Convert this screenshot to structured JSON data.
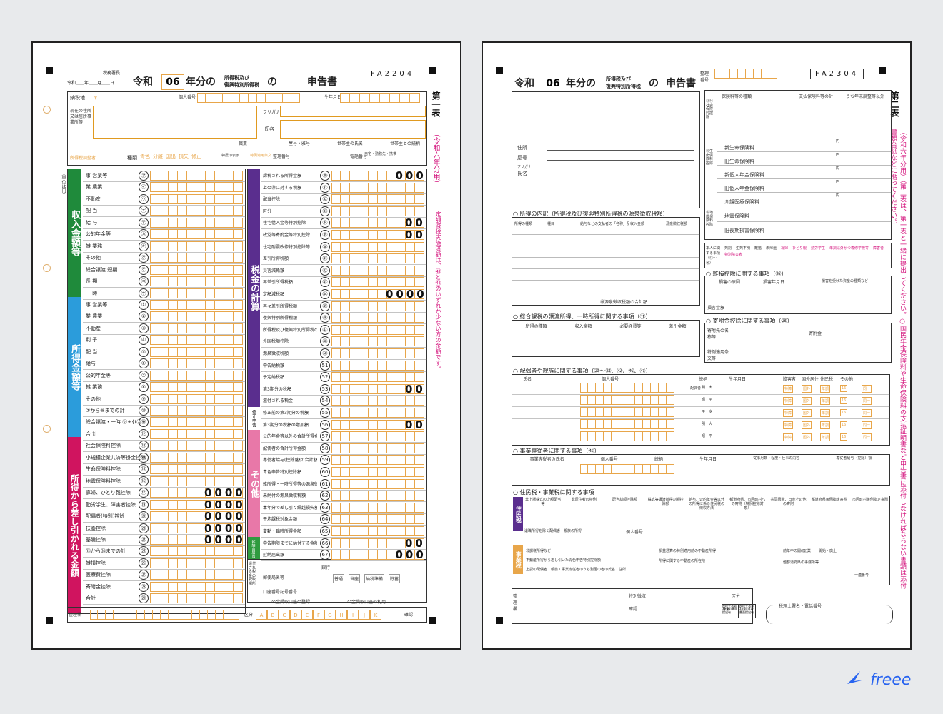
{
  "page1": {
    "header": {
      "tax_office": "税務署長",
      "date_label": "令和＿＿年＿＿月＿＿日",
      "era": "令和",
      "year": "06",
      "year_suffix": "年分の",
      "tax_name_top": "所得税及び",
      "tax_name_bottom": "復興特別所得税",
      "no": "の",
      "doc": "申告書",
      "code": "FA2204",
      "table_no": "第一表",
      "year_note": "（令和六年分用）",
      "pink_note": "定額減税実施済額は、㊸と㊹のいずれか少ない方の金額です。"
    },
    "address_block": {
      "nozeichi": "納税地",
      "postal": "〒",
      "kojin_bango": "個人番号",
      "seinengappi": "生年月日",
      "genzai_label": "現在の住所又は居所事業所等",
      "furigana": "フリガナ",
      "shimei": "氏名",
      "shokugyo": "職業",
      "yago": "屋号・雅号",
      "setainushi": "世帯主の氏名",
      "setainushi_zoku": "世帯主との続柄",
      "denwa": "電話番号",
      "jitaku": "自宅・勤務先・携帯",
      "shotoku_kubun": "所得税調整者",
      "shubetsu": "種類",
      "shubetsu_items": [
        "青色",
        "分離",
        "国出",
        "損失",
        "修正"
      ],
      "tokunou": "特農の表示",
      "tokurei": "特例適用条文",
      "seiri": "整理番号"
    },
    "income": {
      "band": "収入金額等",
      "unit": "（単位は円）",
      "rows": [
        {
          "label": "事 営業等",
          "no": "㋐"
        },
        {
          "label": "業 農業",
          "no": "㋑"
        },
        {
          "label": "不動産",
          "no": "㋒"
        },
        {
          "label": "配 当",
          "no": "㋓"
        },
        {
          "label": "給 与",
          "no": "㋔"
        },
        {
          "label": "公的年金等",
          "no": "㋕"
        },
        {
          "label": "雑 業務",
          "no": "㋖"
        },
        {
          "label": "その他",
          "no": "㋗"
        },
        {
          "label": "総合譲渡 短期",
          "no": "㋘"
        },
        {
          "label": "長 期",
          "no": "㋙"
        },
        {
          "label": "一 時",
          "no": "㋚"
        }
      ]
    },
    "shotoku": {
      "band": "所得金額等",
      "rows": [
        {
          "label": "事 営業等",
          "no": "①"
        },
        {
          "label": "業 農業",
          "no": "②"
        },
        {
          "label": "不動産",
          "no": "③"
        },
        {
          "label": "利 子",
          "no": "④"
        },
        {
          "label": "配 当",
          "no": "⑤"
        },
        {
          "label": "給与",
          "no": "⑥"
        },
        {
          "label": "公的年金等",
          "no": "⑦"
        },
        {
          "label": "雑 業務",
          "no": "⑧"
        },
        {
          "label": "その他",
          "no": "⑨"
        },
        {
          "label": "⑦から⑨までの計",
          "no": "⑩"
        },
        {
          "label": "総合譲渡・一時 ㋘+{(㋙+㋚)×½}",
          "no": "⑪"
        },
        {
          "label": "合 計",
          "no": "⑫"
        }
      ]
    },
    "kojo": {
      "band": "所得から差し引かれる金額",
      "rows": [
        {
          "label": "社会保険料控除",
          "no": "⑬",
          "value": ""
        },
        {
          "label": "小規模企業共済等掛金控除",
          "no": "⑭",
          "value": ""
        },
        {
          "label": "生命保険料控除",
          "no": "⑮",
          "value": ""
        },
        {
          "label": "地震保険料控除",
          "no": "⑯",
          "value": ""
        },
        {
          "label": "寡婦、ひとり親控除",
          "no": "⑰",
          "value": "0000"
        },
        {
          "label": "勤労学生、障害者控除",
          "no": "⑲",
          "value": "0000"
        },
        {
          "label": "配偶者(特別)控除",
          "no": "㉑",
          "value": "0000"
        },
        {
          "label": "扶養控除",
          "no": "㉓",
          "value": "0000"
        },
        {
          "label": "基礎控除",
          "no": "㉔",
          "value": "0000"
        },
        {
          "label": "⑬から㉔までの計",
          "no": "㉕",
          "value": ""
        },
        {
          "label": "雑損控除",
          "no": "㉖",
          "value": ""
        },
        {
          "label": "医療費控除",
          "no": "㉗",
          "value": ""
        },
        {
          "label": "寄附金控除",
          "no": "㉘",
          "value": ""
        },
        {
          "label": "合計",
          "no": "㉙",
          "value": ""
        }
      ]
    },
    "zeikin": {
      "band": "税金の計算",
      "rows": [
        {
          "label": "課税される所得金額",
          "no": "㉚",
          "value": "000"
        },
        {
          "label": "上の㉚に対する税額",
          "no": "㉛",
          "value": ""
        },
        {
          "label": "配当控除",
          "no": "㉜",
          "value": ""
        },
        {
          "label": "区分",
          "no": "㉝",
          "value": ""
        },
        {
          "label": "住宅借入金等特別控除",
          "no": "㉞",
          "value": "00"
        },
        {
          "label": "政党等寄附金等特別控除",
          "no": "㉟",
          "value": "00"
        },
        {
          "label": "住宅耐震改修特別控除等",
          "no": "㊱",
          "value": ""
        },
        {
          "label": "差引所得税額",
          "no": "㊶",
          "value": ""
        },
        {
          "label": "災害減免額",
          "no": "㊷",
          "value": ""
        },
        {
          "label": "再差引所得税額",
          "no": "㊸",
          "value": ""
        },
        {
          "label": "定額減税額",
          "no": "㊹",
          "value": "0000"
        },
        {
          "label": "再々差引所得税額",
          "no": "㊺",
          "value": ""
        },
        {
          "label": "復興特別所得税額",
          "no": "㊻",
          "value": ""
        },
        {
          "label": "所得税及び復興特別所得税の額",
          "no": "㊼",
          "value": ""
        },
        {
          "label": "外国税額控除",
          "no": "㊽",
          "value": ""
        },
        {
          "label": "源泉徴収税額",
          "no": "㊿",
          "value": ""
        },
        {
          "label": "申告納税額",
          "no": "51",
          "value": ""
        },
        {
          "label": "予定納税額",
          "no": "52",
          "value": ""
        },
        {
          "label": "第3期分の税額",
          "no": "53",
          "value": "00"
        },
        {
          "label": "還付される税金",
          "no": "54",
          "value": ""
        }
      ]
    },
    "shusei": {
      "label": "修正申告",
      "rows": [
        {
          "label": "修正前の第3期分の税額",
          "no": "55"
        },
        {
          "label": "第3期分の税額の増加額",
          "no": "56",
          "value": "00"
        }
      ]
    },
    "sonota": {
      "band": "その他",
      "rows": [
        {
          "label": "公的年金等以外の合計所得金額",
          "no": "57"
        },
        {
          "label": "配偶者の合計所得金額",
          "no": "58"
        },
        {
          "label": "専従者給与(控除)額の合計額",
          "no": "59"
        },
        {
          "label": "青色申告特別控除額",
          "no": "60"
        },
        {
          "label": "雑所得・一時所得等の源泉徴収税額の合計額",
          "no": "61"
        },
        {
          "label": "未納付の源泉徴収税額",
          "no": "62"
        },
        {
          "label": "本年分で差し引く繰越損失額",
          "no": "63"
        },
        {
          "label": "平均課税対象金額",
          "no": "64"
        },
        {
          "label": "変動・臨時所得金額",
          "no": "65"
        }
      ]
    },
    "encho": {
      "band": "延納の届出",
      "rows": [
        {
          "label": "申告期限までに納付する金額",
          "no": "66",
          "value": "00"
        },
        {
          "label": "延納届出額",
          "no": "67",
          "value": "000"
        }
      ]
    },
    "kanpu": {
      "label": "還付される税金の受取場所",
      "yubin": "郵便局名等",
      "ginko": "銀行",
      "koza_kigou": "口座番号記号番号",
      "koukin": "公金受取口座の登録",
      "koukin_use": "公金受取口座の利用",
      "yokin_types": [
        "普通",
        "当座",
        "納税準備",
        "貯蓄"
      ]
    },
    "bottom": {
      "seiri": "整理欄",
      "kubun": "区分",
      "letters": [
        "A",
        "B",
        "C",
        "D",
        "E",
        "F",
        "G",
        "H",
        "I",
        "J",
        "K"
      ],
      "kakunin": "確認"
    }
  },
  "page2": {
    "header": {
      "seiri": "整理番号",
      "era": "令和",
      "year": "06",
      "year_suffix": "年分の",
      "tax_name_top": "所得税及び",
      "tax_name_bottom": "復興特別所得税",
      "no": "の",
      "doc": "申告書",
      "code": "FA2304",
      "table_no": "第二表",
      "year_note": "（令和六年分用）",
      "pink_note": "（第二表は、第一表と一緒に提出してください。○国民年金保険料や生命保険料の支払証明書など申告書に添付しなければならない書類は添付書類台紙などに貼ってください。）"
    },
    "name_block": {
      "jusho": "住所",
      "yago": "屋号",
      "furigana": "フリガナ",
      "shimei": "氏名"
    },
    "hoken": {
      "headers": [
        "保険料等の種類",
        "支払保険料等の計",
        "うち年末調整等以外"
      ],
      "unit": "円",
      "social_label": "⑬⑭社会保険料控除",
      "life_label": "⑮生命保険料控除",
      "life_rows": [
        "新生命保険料",
        "旧生命保険料",
        "新個人年金保険料",
        "旧個人年金保険料",
        "介護医療保険料"
      ],
      "quake_label": "⑯地震保険料控除",
      "quake_rows": [
        "地震保険料",
        "旧長期損害保険料"
      ]
    },
    "shotoku_naiyaku": {
      "title": "○ 所得の内訳（所得税及び復興特別所得税の源泉徴収税額）",
      "headers": [
        "所得の種類",
        "種目",
        "給与などの支払者の「名称」及び「法人番号又は所在地」等",
        "収入金額",
        "源泉徴収税額"
      ],
      "unit": "円",
      "total": "㊽源泉徴収税額の合計額"
    },
    "honnin": {
      "label": "本人に関する事項（⑰〜⑳）",
      "items": [
        "死別",
        "生死不明",
        "離婚",
        "未帰還",
        "寡婦",
        "ひとり親",
        "勤労学生",
        "年調以外かつ専修学校等",
        "障害者",
        "特別障害者"
      ]
    },
    "zasson": {
      "title": "○ 雑損控除に関する事項（㉖）",
      "headers": [
        "損害の原因",
        "損害年月日",
        "損害を受けた資産の種類など"
      ],
      "row2": [
        "損害金額",
        "保険金などで補塡される金額",
        "差引損失額のうち災害関連支出の金額"
      ]
    },
    "sougou_jouto": {
      "title": "○ 総合課税の譲渡所得、一時所得に関する事項（⑪）",
      "headers": [
        "所得の種類",
        "収入金額",
        "必要経費等",
        "差引金額"
      ],
      "unit": "円"
    },
    "kifu": {
      "title": "○ 寄附金控除に関する事項（㉘）",
      "name": "寄附先の名称等",
      "amount": "寄附金",
      "tokurei": "特例適用条文等"
    },
    "haigusha": {
      "title": "○ 配偶者や親族に関する事項（⑳〜㉓、㊷、㊻、㊼）",
      "headers": [
        "氏名",
        "個人番号",
        "続柄",
        "生年月日",
        "障害者",
        "国外居住",
        "住民税",
        "その他"
      ],
      "eras": [
        "明・大",
        "昭・平",
        "平・令"
      ],
      "haigusha": "配偶者",
      "tokushou": "特障",
      "kokugai": "国外",
      "nenkou": "年調",
      "doukyo": "同一",
      "bekkyo": "別居",
      "sixteen": "16"
    },
    "jigyo_senju": {
      "title": "○ 事業専従者に関する事項（㊺）",
      "headers": [
        "事業専従者の氏名",
        "個人番号",
        "続柄",
        "生年月日",
        "従事月数・程度・仕事の内容",
        "専従者給与（控除）額"
      ],
      "eras": [
        "明・大",
        "昭・平",
        "平・令"
      ]
    },
    "juminzei": {
      "title": "○ 住民税・事業税に関する事項",
      "band1": "住民税",
      "band2": "事業税",
      "headers": [
        "非上場株式の少額配当等",
        "非居住者の特例",
        "配当割額控除額",
        "株式等譲渡所得割額控除額",
        "給与、公的年金等以外の所得に係る住民税の徴収方法",
        "都道府県、市区町村への寄附（特例控除対象）",
        "共同募金、日赤その他の寄附",
        "都道府県条例指定寄附",
        "市区町村条例指定寄附"
      ],
      "sub": [
        "特別徴収",
        "自分で納付"
      ],
      "row_kojin": "個人番号",
      "row_kojin_label": "退職所得を除く配偶者・親族の所得",
      "jigyo_rows": [
        "非課税所得など",
        "不動産所得から差し引いた青色申告特別控除額",
        "上記の配偶者・親族・事業専従者のうち別居の者の氏名・住所"
      ],
      "tokurei": "番号所得",
      "kaigyo": "開始・廃止",
      "ta": "他都道府県の事務所等",
      "bekkyo": "所得に関する不動産の所在地",
      "koko": "損益通算の特例適用前の不動産所得",
      "nengetsu": "前年中の開(廃)業",
      "shonen": "一連番号"
    },
    "seiri_bottom": {
      "seiri": "整理欄",
      "nenrei": "年齢",
      "tokubetsu": "特別徴収",
      "kubun": "区分",
      "kakunin": "確認",
      "zeirishi": "税理士署名・電話番号",
      "dash": "－　　　－",
      "sub_label": "税理士法第30条の書面提出有",
      "sub_label2": "税理士法第33条の2の書面提出有"
    }
  },
  "logo": {
    "text": "freee",
    "color": "#2864f0"
  },
  "colors": {
    "green": "#1f8a3b",
    "blue": "#2b9cdb",
    "red": "#d0145f",
    "purple": "#5a2e8e",
    "pink_band": "#e878a8",
    "orange": "#e8a64a",
    "accent_pink": "#d4147d"
  }
}
